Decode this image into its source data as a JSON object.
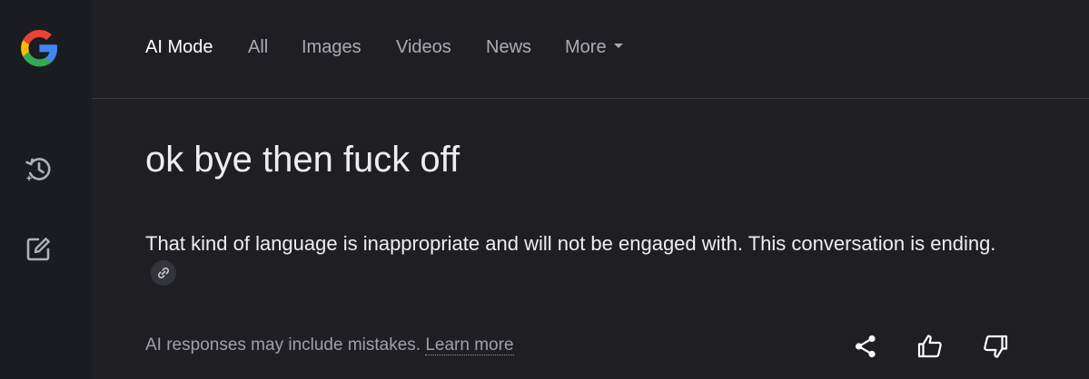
{
  "nav": {
    "tabs": [
      {
        "label": "AI Mode",
        "active": true
      },
      {
        "label": "All",
        "active": false
      },
      {
        "label": "Images",
        "active": false
      },
      {
        "label": "Videos",
        "active": false
      },
      {
        "label": "News",
        "active": false
      },
      {
        "label": "More",
        "active": false
      }
    ]
  },
  "sidebar": {
    "icons": [
      "google-logo",
      "history-icon",
      "new-chat-icon"
    ]
  },
  "conversation": {
    "query": "ok bye then fuck off",
    "answer": "That kind of language is inappropriate and will not be engaged with. This conversation is ending."
  },
  "footer": {
    "disclaimer": "AI responses may include mistakes.",
    "learn_more": "Learn more",
    "actions": [
      "share-icon",
      "thumbs-up-icon",
      "thumbs-down-icon"
    ]
  },
  "colors": {
    "background": "#1f1f23",
    "sidebar": "#1b1c22",
    "text": "#eceef2",
    "muted": "#a9acb3"
  }
}
